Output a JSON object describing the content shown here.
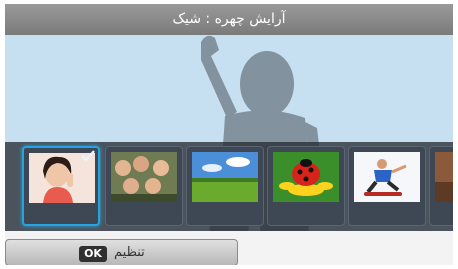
{
  "title": "آرایش چهره : شیک",
  "thumbnails": [
    {
      "subject": "portrait-woman",
      "selected": true
    },
    {
      "subject": "group-photo",
      "selected": false
    },
    {
      "subject": "landscape-field",
      "selected": false
    },
    {
      "subject": "ladybug-flower",
      "selected": false
    },
    {
      "subject": "skateboarder",
      "selected": false
    },
    {
      "subject": "partial-photo",
      "selected": false
    }
  ],
  "footer": {
    "ok_key": "OK",
    "ok_label": "تنظیم"
  },
  "colors": {
    "screen_bg": "#c6dff1",
    "selection": "#26a4e0",
    "title_bar": "#8a8a8a"
  }
}
